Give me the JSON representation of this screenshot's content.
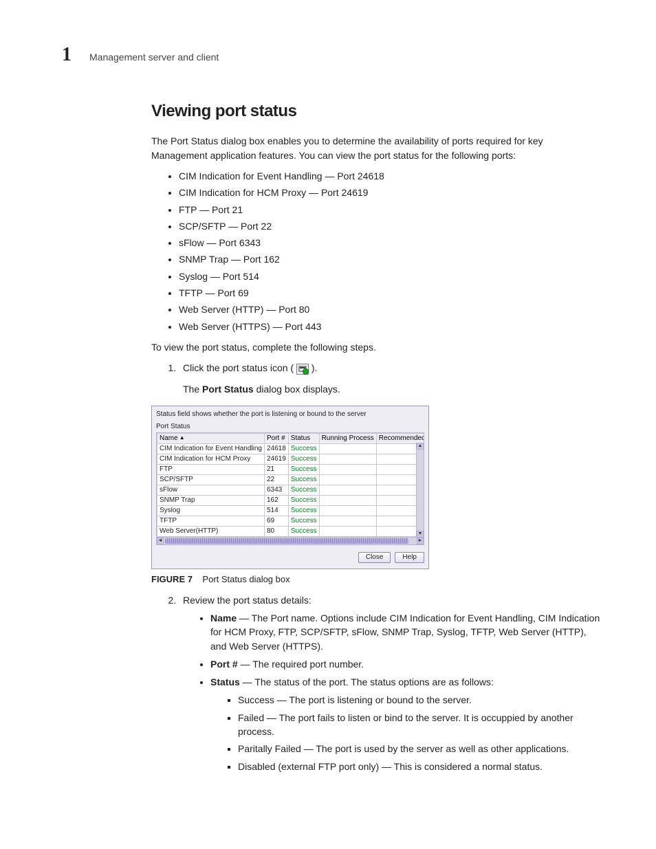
{
  "header": {
    "chapter_number": "1",
    "chapter_title": "Management server and client"
  },
  "section": {
    "title": "Viewing port status",
    "intro": "The Port Status dialog box enables you to determine the availability of ports required for key Management application features. You can view the port status for the following ports:",
    "ports": [
      "CIM Indication for Event Handling — Port 24618",
      "CIM Indication for HCM Proxy — Port 24619",
      "FTP — Port 21",
      "SCP/SFTP — Port 22",
      "sFlow — Port 6343",
      "SNMP Trap — Port 162",
      "Syslog — Port 514",
      "TFTP — Port 69",
      "Web Server (HTTP) — Port 80",
      "Web Server (HTTPS) — Port 443"
    ],
    "lead_out": "To view the port status, complete the following steps."
  },
  "steps": {
    "step1_pre": "Click the port status icon (",
    "step1_post": ").",
    "step1_sub_prefix": "The ",
    "step1_sub_bold": "Port Status",
    "step1_sub_suffix": " dialog box displays.",
    "step2": "Review the port status details:"
  },
  "dialog": {
    "hint": "Status field shows whether the port is listening or bound to the server",
    "group_label": "Port Status",
    "columns": [
      "Name",
      "Port #",
      "Status",
      "Running Process",
      "Recommended Actio"
    ],
    "rows": [
      {
        "name": "CIM Indication for Event Handling",
        "port": "24618",
        "status": "Success"
      },
      {
        "name": "CIM Indication for HCM Proxy",
        "port": "24619",
        "status": "Success"
      },
      {
        "name": "FTP",
        "port": "21",
        "status": "Success"
      },
      {
        "name": "SCP/SFTP",
        "port": "22",
        "status": "Success"
      },
      {
        "name": "sFlow",
        "port": "6343",
        "status": "Success"
      },
      {
        "name": "SNMP Trap",
        "port": "162",
        "status": "Success"
      },
      {
        "name": "Syslog",
        "port": "514",
        "status": "Success"
      },
      {
        "name": "TFTP",
        "port": "69",
        "status": "Success"
      },
      {
        "name": "Web Server(HTTP)",
        "port": "80",
        "status": "Success"
      }
    ],
    "buttons": {
      "close": "Close",
      "help": "Help"
    }
  },
  "figure": {
    "number": "FIGURE 7",
    "caption": "Port Status dialog box"
  },
  "details": {
    "name_label": "Name",
    "name_text": " — The Port name. Options include CIM Indication for Event Handling, CIM Indication for HCM Proxy, FTP, SCP/SFTP, sFlow, SNMP Trap, Syslog, TFTP, Web Server (HTTP), and Web Server (HTTPS).",
    "port_label": "Port #",
    "port_text": " — The required port number.",
    "status_label": "Status",
    "status_text": " — The status of the port. The status options are as follows:",
    "status_opts": [
      "Success — The port is listening or bound to the server.",
      "Failed — The port fails to listen or bind to the server. It is occuppied by another process.",
      "Paritally Failed — The port is used by the server as well as other applications.",
      "Disabled (external FTP port only) — This is considered a normal status."
    ]
  }
}
